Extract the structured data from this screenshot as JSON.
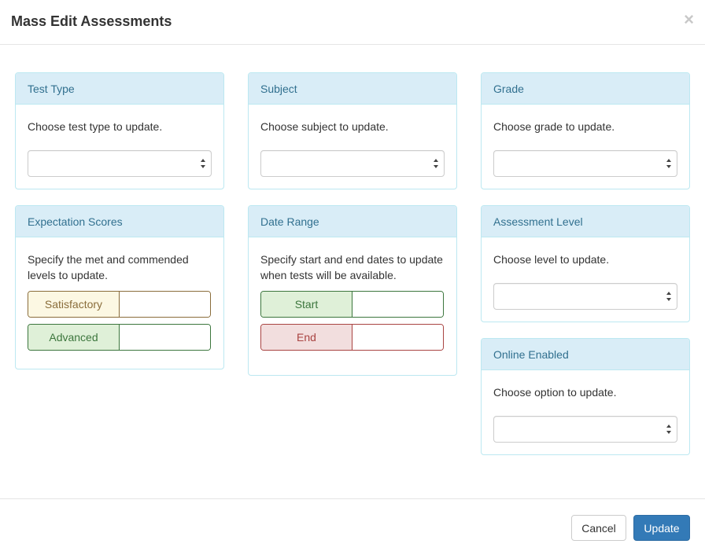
{
  "modal": {
    "title": "Mass Edit Assessments",
    "close_glyph": "×"
  },
  "panels": {
    "test_type": {
      "heading": "Test Type",
      "description": "Choose test type to update.",
      "selected": ""
    },
    "subject": {
      "heading": "Subject",
      "description": "Choose subject to update.",
      "selected": ""
    },
    "grade": {
      "heading": "Grade",
      "description": "Choose grade to update.",
      "selected": ""
    },
    "expectation_scores": {
      "heading": "Expectation Scores",
      "description": "Specify the met and commended levels to update.",
      "satisfactory_label": "Satisfactory",
      "satisfactory_value": "",
      "advanced_label": "Advanced",
      "advanced_value": ""
    },
    "date_range": {
      "heading": "Date Range",
      "description": "Specify start and end dates to update when tests will be available.",
      "start_label": "Start",
      "start_value": "",
      "end_label": "End",
      "end_value": ""
    },
    "assessment_level": {
      "heading": "Assessment Level",
      "description": "Choose level to update.",
      "selected": ""
    },
    "online_enabled": {
      "heading": "Online Enabled",
      "description": "Choose option to update.",
      "selected": ""
    }
  },
  "footer": {
    "cancel_label": "Cancel",
    "update_label": "Update"
  },
  "colors": {
    "panel_heading_bg": "#d9edf7",
    "panel_heading_text": "#31708f",
    "warning_addon": "#fcf8e3",
    "success_addon": "#dff0d8",
    "danger_addon": "#f2dede",
    "primary_button": "#337ab7"
  },
  "icons": {
    "select_arrows": "select-arrows-icon",
    "close": "close-icon"
  }
}
